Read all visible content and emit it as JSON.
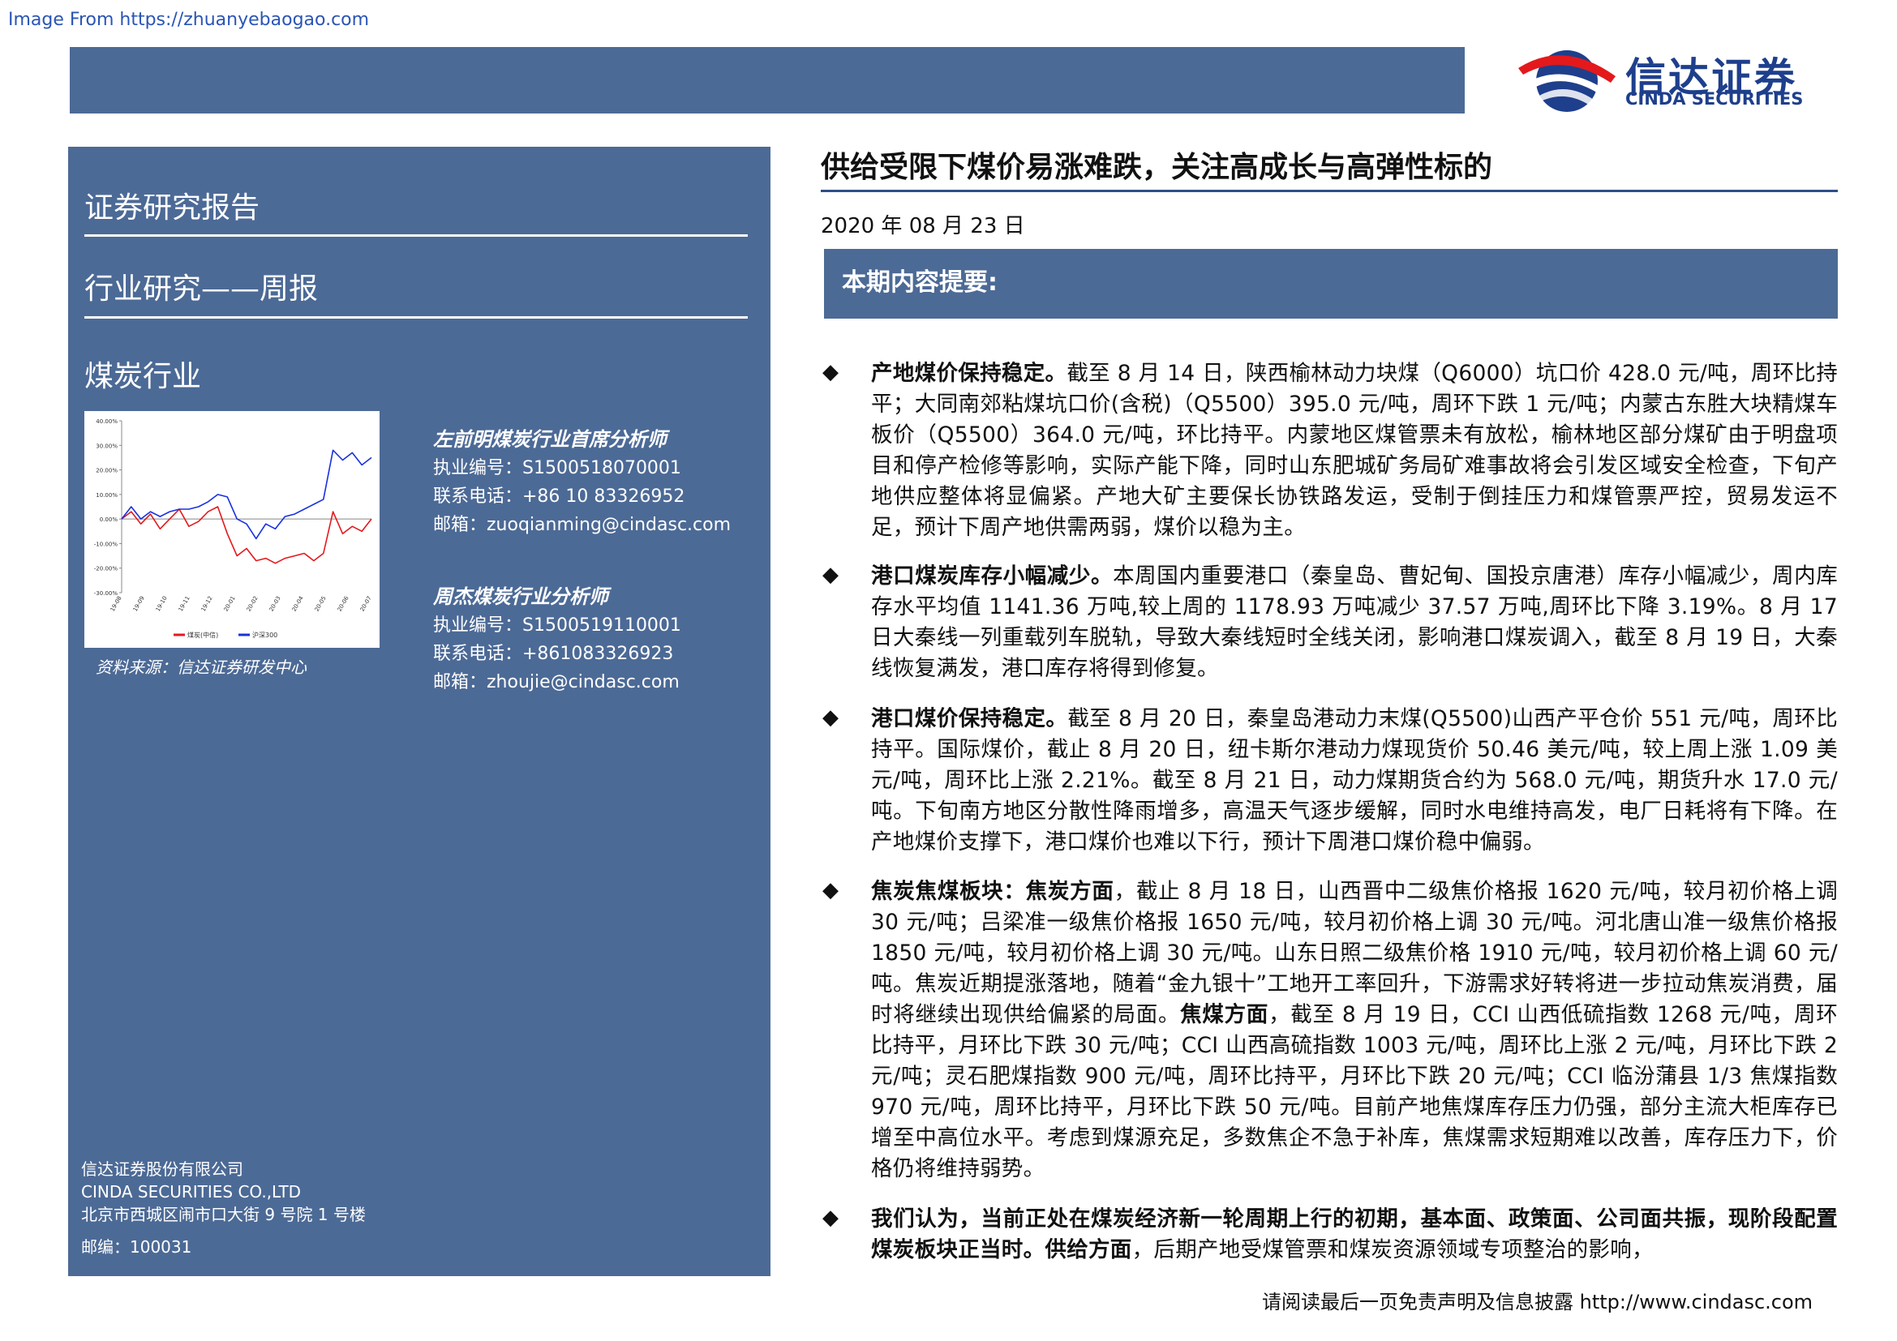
{
  "source_url": "Image From https://zhuanyebaogao.com",
  "logo": {
    "cn": "信达证券",
    "en": "CINDA SECURITIES"
  },
  "sidebar": {
    "report_type": "证券研究报告",
    "category": "行业研究——周报",
    "industry": "煤炭行业",
    "chart_source": "资料来源：信达证券研发中心",
    "analysts": [
      {
        "name": "左前明煤炭行业首席分析师",
        "cert": "执业编号：S1500518070001",
        "phone": "联系电话：+86 10 83326952",
        "email": "邮箱：zuoqianming@cindasc.com"
      },
      {
        "name": "周杰煤炭行业分析师",
        "cert": "执业编号：S1500519110001",
        "phone": "联系电话：+861083326923",
        "email": "邮箱：zhoujie@cindasc.com"
      }
    ],
    "company": {
      "cn": "信达证券股份有限公司",
      "en": "CINDA SECURITIES CO.,LTD",
      "address": "北京市西城区闹市口大街 9 号院 1 号楼",
      "postal": "邮编：100031"
    }
  },
  "chart_data": {
    "type": "line",
    "title": "",
    "ylim": [
      -0.3,
      0.4
    ],
    "y_ticks": [
      "40.00%",
      "30.00%",
      "20.00%",
      "10.00%",
      "0.00%",
      "-10.00%",
      "-20.00%",
      "-30.00%"
    ],
    "x_ticks": [
      "19-08",
      "19-09",
      "19-10",
      "19-11",
      "19-12",
      "20-01",
      "20-02",
      "20-03",
      "20-04",
      "20-05",
      "20-06",
      "20-07"
    ],
    "series": [
      {
        "name": "煤炭(中信)",
        "color": "#e3191c",
        "values": [
          0.0,
          0.03,
          -0.02,
          0.02,
          -0.04,
          0.0,
          0.04,
          -0.03,
          -0.01,
          0.03,
          0.05,
          -0.06,
          -0.15,
          -0.12,
          -0.17,
          -0.16,
          -0.18,
          -0.16,
          -0.15,
          -0.14,
          -0.17,
          -0.14,
          0.03,
          -0.06,
          -0.03,
          -0.05,
          0.0
        ]
      },
      {
        "name": "沪深300",
        "color": "#1830e0",
        "values": [
          0.0,
          0.05,
          0.0,
          0.03,
          0.01,
          0.03,
          0.04,
          0.04,
          0.05,
          0.07,
          0.1,
          0.09,
          0.0,
          -0.02,
          -0.08,
          -0.02,
          -0.04,
          0.01,
          0.02,
          0.04,
          0.06,
          0.08,
          0.28,
          0.24,
          0.27,
          0.22,
          0.25
        ]
      }
    ]
  },
  "report": {
    "title": "供给受限下煤价易涨难跌，关注高成长与高弹性标的",
    "date": "2020 年 08 月 23 日",
    "summary_label": "本期内容提要:",
    "bullets": [
      {
        "bold": "产地煤价保持稳定。",
        "text": "截至 8 月 14 日，陕西榆林动力块煤（Q6000）坑口价 428.0 元/吨，周环比持平；大同南郊粘煤坑口价(含税)（Q5500）395.0 元/吨，周环下跌 1 元/吨；内蒙古东胜大块精煤车板价（Q5500）364.0 元/吨，环比持平。内蒙地区煤管票未有放松，榆林地区部分煤矿由于明盘项目和停产检修等影响，实际产能下降，同时山东肥城矿务局矿难事故将会引发区域安全检查，下旬产地供应整体将显偏紧。产地大矿主要保长协铁路发运，受制于倒挂压力和煤管票严控，贸易发运不足，预计下周产地供需两弱，煤价以稳为主。"
      },
      {
        "bold": "港口煤炭库存小幅减少。",
        "text": "本周国内重要港口（秦皇岛、曹妃甸、国投京唐港）库存小幅减少，周内库存水平均值 1141.36 万吨,较上周的 1178.93 万吨减少 37.57 万吨,周环比下降 3.19%。8 月 17 日大秦线一列重载列车脱轨，导致大秦线短时全线关闭，影响港口煤炭调入，截至 8 月 19 日，大秦线恢复满发，港口库存将得到修复。"
      },
      {
        "bold": "港口煤价保持稳定。",
        "text": "截至 8 月 20 日，秦皇岛港动力末煤(Q5500)山西产平仓价 551 元/吨，周环比持平。国际煤价，截止 8 月 20 日，纽卡斯尔港动力煤现货价 50.46 美元/吨，较上周上涨 1.09 美元/吨，周环比上涨 2.21%。截至 8 月 21 日，动力煤期货合约为 568.0 元/吨，期货升水 17.0 元/吨。下旬南方地区分散性降雨增多，高温天气逐步缓解，同时水电维持高发，电厂日耗将有下降。在产地煤价支撑下，港口煤价也难以下行，预计下周港口煤价稳中偏弱。"
      },
      {
        "bold": "焦炭焦煤板块：焦炭方面",
        "text": "，截止 8 月 18 日，山西晋中二级焦价格报 1620 元/吨，较月初价格上调 30 元/吨；吕梁准一级焦价格报 1650 元/吨，较月初价格上调 30 元/吨。河北唐山准一级焦价格报 1850 元/吨，较月初价格上调 30 元/吨。山东日照二级焦价格 1910 元/吨，较月初价格上调 60 元/吨。焦炭近期提涨落地，随着“金九银十”工地开工率回升，下游需求好转将进一步拉动焦炭消费，届时将继续出现供给偏紧的局面。",
        "bold2": "焦煤方面",
        "text2": "，截至 8 月 19 日，CCI 山西低硫指数 1268 元/吨，周环比持平，月环比下跌 30 元/吨；CCI 山西高硫指数 1003 元/吨，周环比上涨 2 元/吨，月环比下跌 2 元/吨；灵石肥煤指数 900 元/吨，周环比持平，月环比下跌 20 元/吨；CCI 临汾蒲县 1/3 焦煤指数 970 元/吨，周环比持平，月环比下跌 50 元/吨。目前产地焦煤库存压力仍强，部分主流大柜库存已增至中高位水平。考虑到煤源充足，多数焦企不急于补库，焦煤需求短期难以改善，库存压力下，价格仍将维持弱势。"
      },
      {
        "bold": "我们认为，当前正处在煤炭经济新一轮周期上行的初期，基本面、政策面、公司面共振，现阶段配置煤炭板块正当时。供给方面",
        "text": "，后期产地受煤管票和煤炭资源领域专项整治的影响，"
      }
    ]
  },
  "footer": {
    "note": "请阅读最后一页免责声明及信息披露  http://www.cindasc.com"
  }
}
